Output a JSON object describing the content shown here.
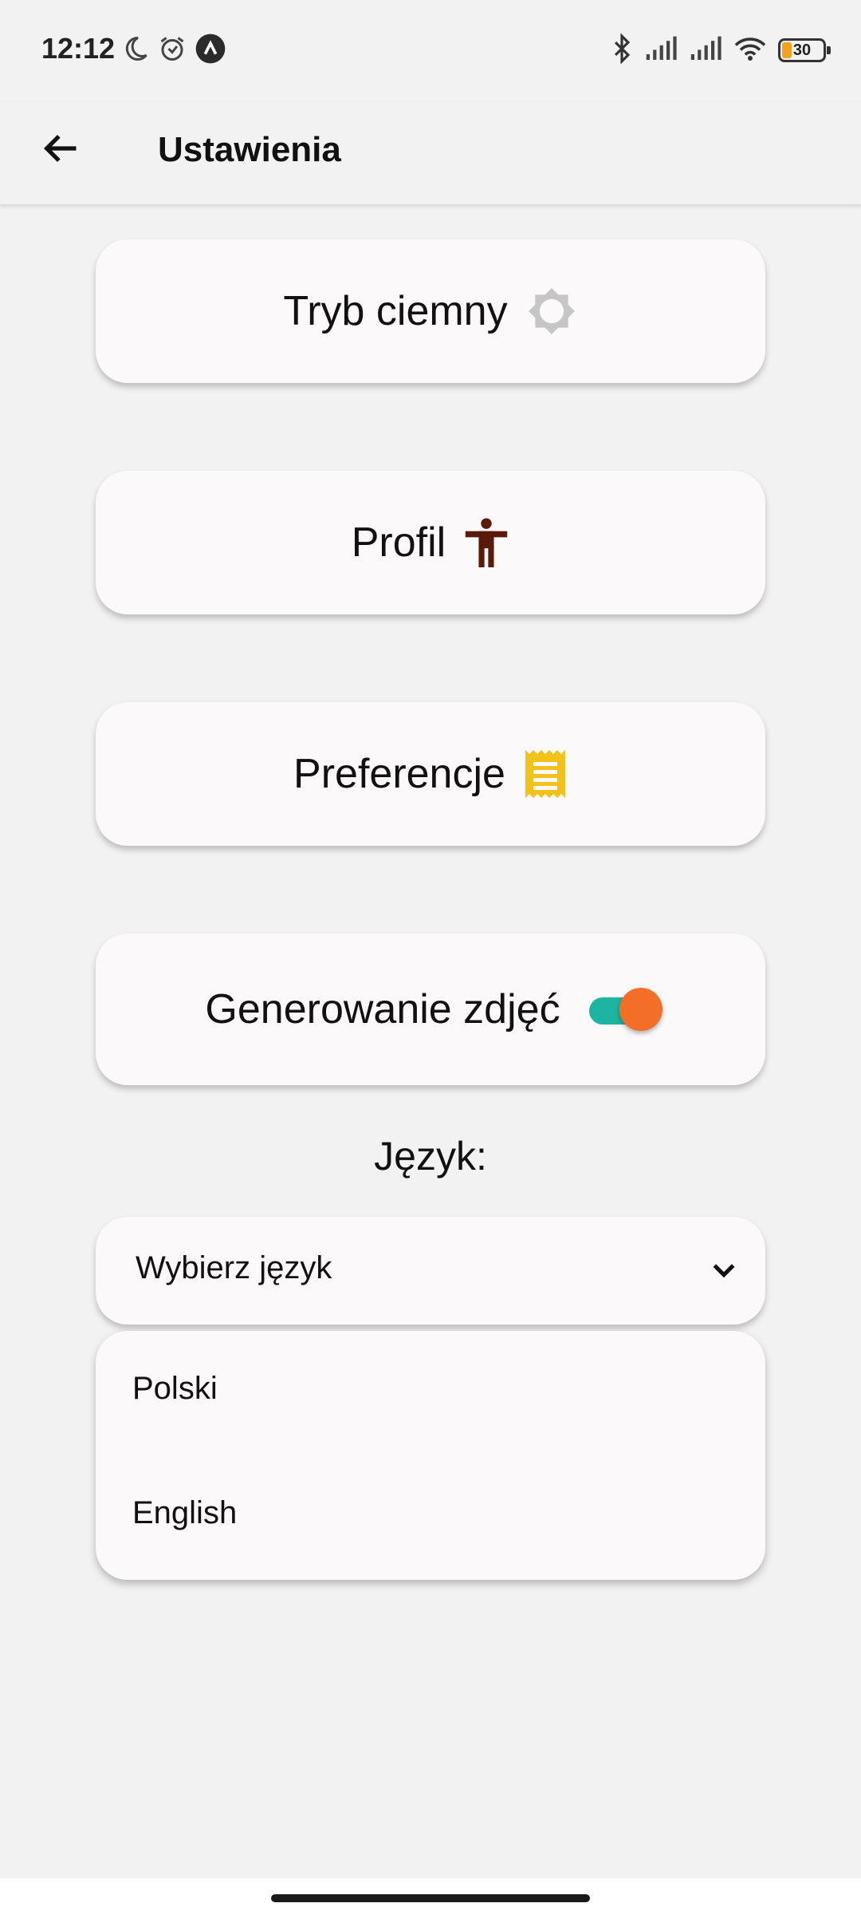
{
  "status_bar": {
    "time": "12:12",
    "left_icons": [
      "moon-icon",
      "alarm-icon",
      "app-notification-icon"
    ],
    "right_icons": [
      "bluetooth-icon",
      "signal-icon",
      "signal-icon",
      "wifi-icon"
    ],
    "battery": "30",
    "battery_color": "#f3a21f"
  },
  "app_bar": {
    "title": "Ustawienia",
    "back_icon": "arrow-back-icon"
  },
  "settings": {
    "dark_mode": {
      "label": "Tryb ciemny",
      "icon": "brightness-icon",
      "icon_color": "#c2c2c2"
    },
    "profile": {
      "label": "Profil",
      "icon": "accessibility-icon",
      "icon_color": "#5a1a0a"
    },
    "preferences": {
      "label": "Preferencje",
      "icon": "receipt-icon",
      "icon_color": "#f2c21b"
    },
    "image_generation": {
      "label": "Generowanie zdjęć",
      "toggle_on": true,
      "track_color": "#1db5a1",
      "thumb_color": "#f36f28"
    }
  },
  "language": {
    "label": "Język:",
    "select_placeholder": "Wybierz język",
    "options": [
      "Polski",
      "English"
    ]
  }
}
